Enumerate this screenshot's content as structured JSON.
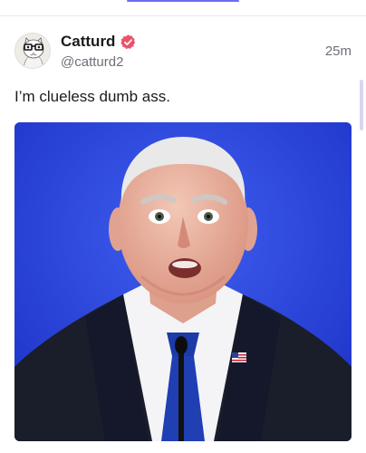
{
  "post": {
    "author": {
      "display_name": "Catturd",
      "handle": "@catturd2",
      "verified": true,
      "avatar_icon": "cat-avatar-icon",
      "verified_icon": "verified-badge-icon"
    },
    "timestamp": "25m",
    "text": "I’m clueless dumb ass.",
    "media": {
      "type": "image"
    }
  },
  "colors": {
    "accent": "#6b6cf6",
    "verified_badge": "#e8546a",
    "name_text": "#1b1b1f",
    "muted_text": "#6e6f79",
    "media_background": "#2b48d9"
  }
}
